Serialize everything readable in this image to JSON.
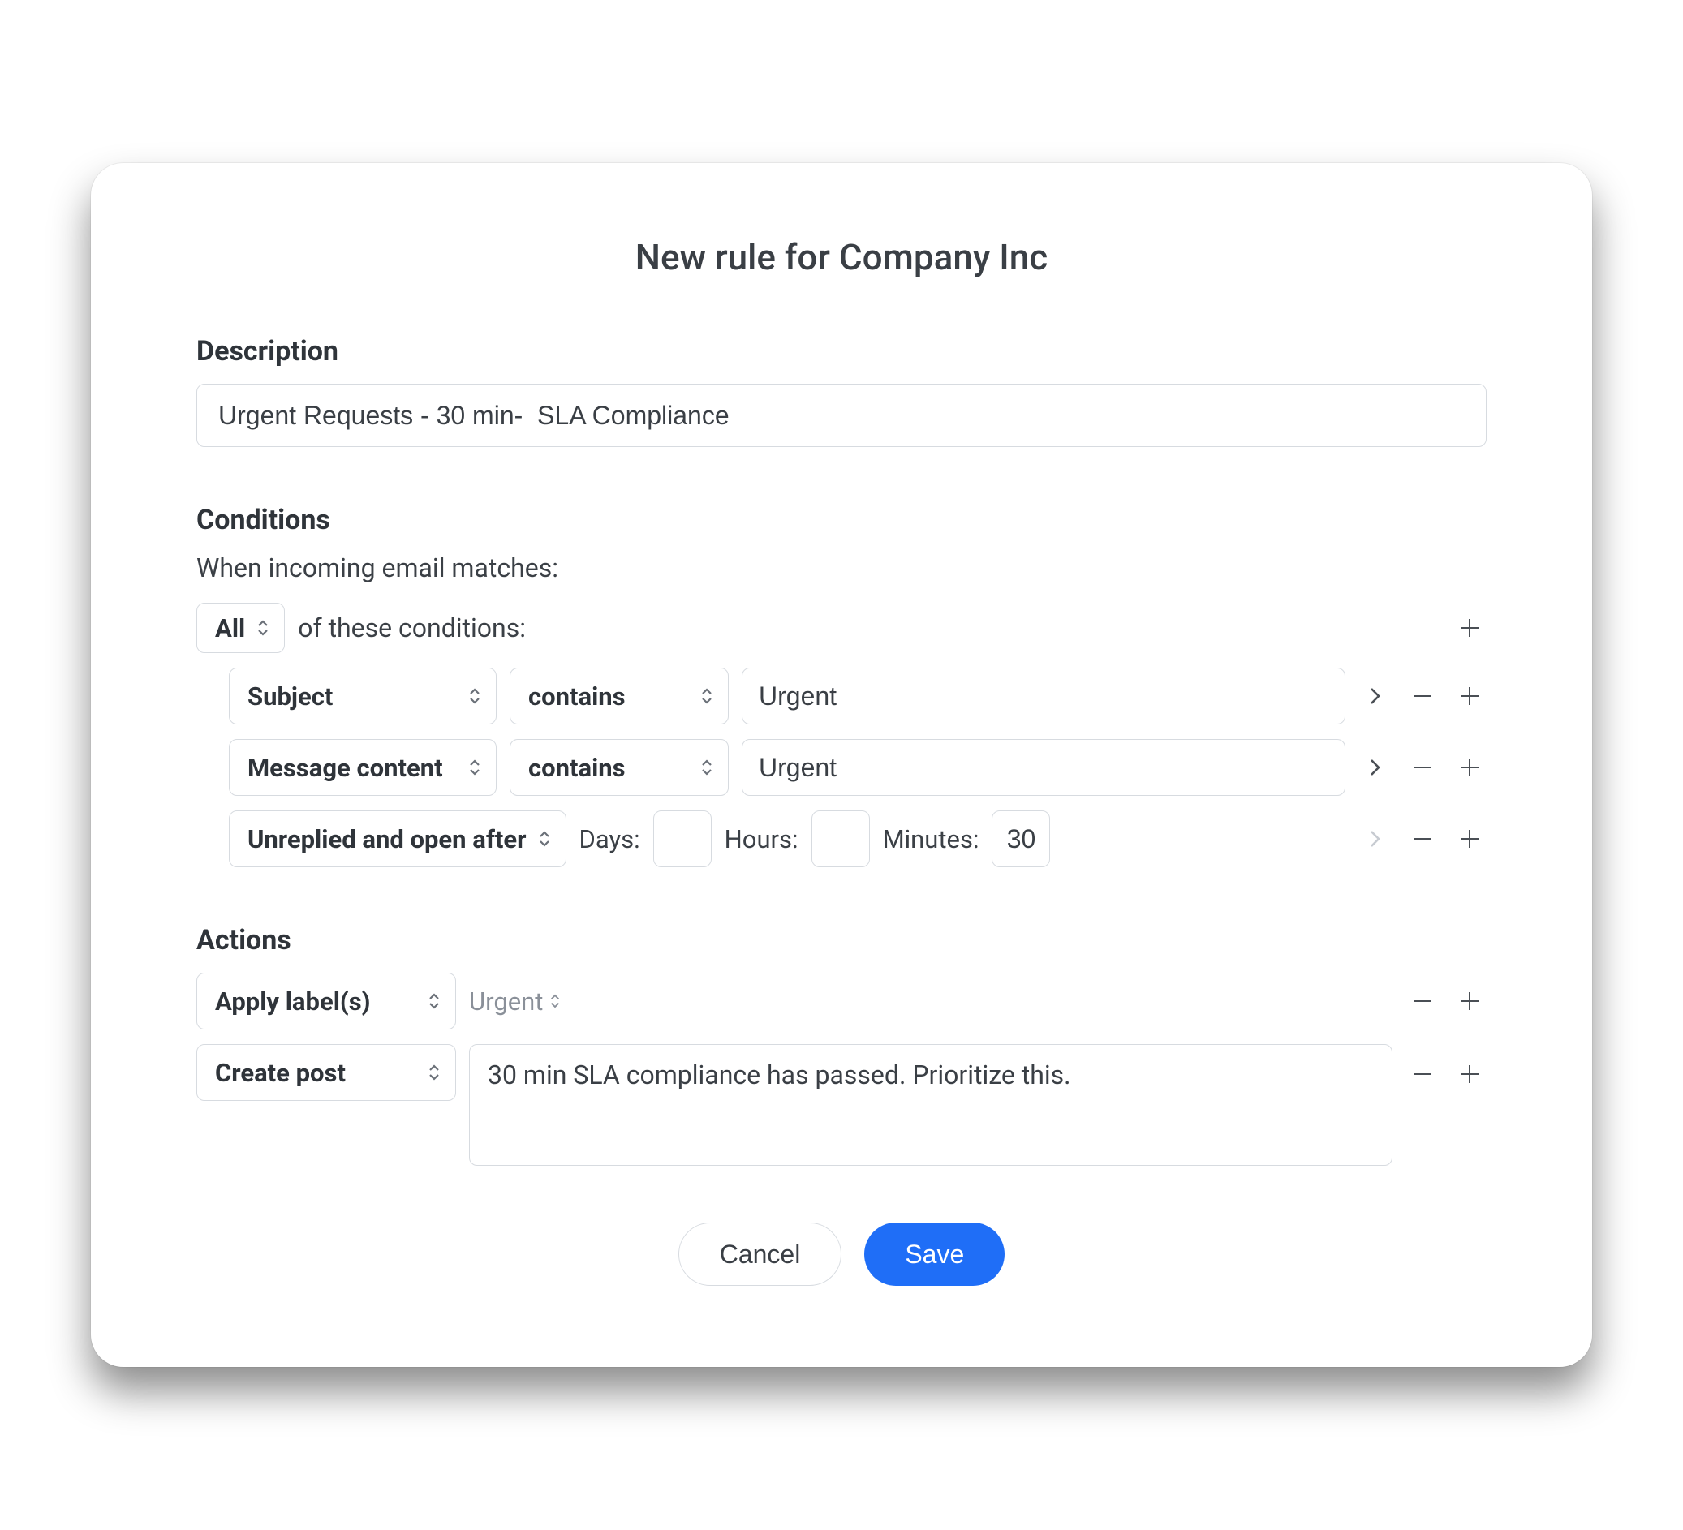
{
  "title": "New rule for Company Inc",
  "description": {
    "label": "Description",
    "value": "Urgent Requests - 30 min-  SLA Compliance"
  },
  "conditions": {
    "label": "Conditions",
    "intro": "When incoming email matches:",
    "match_mode": "All",
    "match_suffix": "of these conditions:",
    "rows": [
      {
        "field": "Subject",
        "operator": "contains",
        "value": "Urgent"
      },
      {
        "field": "Message content",
        "operator": "contains",
        "value": "Urgent"
      }
    ],
    "time_row": {
      "field": "Unreplied and open after",
      "days_label": "Days:",
      "days_value": "",
      "hours_label": "Hours:",
      "hours_value": "",
      "minutes_label": "Minutes:",
      "minutes_value": "30"
    }
  },
  "actions": {
    "label": "Actions",
    "rows": [
      {
        "type": "Apply label(s)",
        "tag": "Urgent"
      },
      {
        "type": "Create post",
        "text": "30 min SLA compliance has passed. Prioritize this."
      }
    ]
  },
  "footer": {
    "cancel": "Cancel",
    "save": "Save"
  }
}
